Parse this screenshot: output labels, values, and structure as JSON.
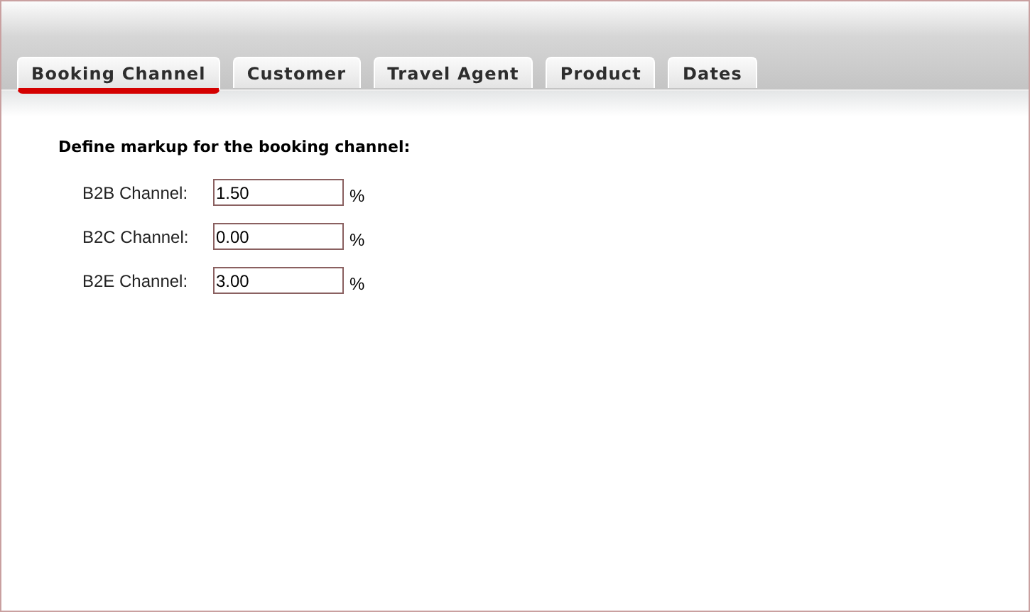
{
  "tabs": [
    {
      "label": "Booking Channel",
      "selected": true
    },
    {
      "label": "Customer",
      "selected": false
    },
    {
      "label": "Travel Agent",
      "selected": false
    },
    {
      "label": "Product",
      "selected": false
    },
    {
      "label": "Dates",
      "selected": false
    }
  ],
  "heading": "Define markup for the booking channel:",
  "fields": [
    {
      "label": "B2B Channel:",
      "value": "1.50",
      "unit": "%"
    },
    {
      "label": "B2C Channel:",
      "value": "0.00",
      "unit": "%"
    },
    {
      "label": "B2E Channel:",
      "value": "3.00",
      "unit": "%"
    }
  ]
}
